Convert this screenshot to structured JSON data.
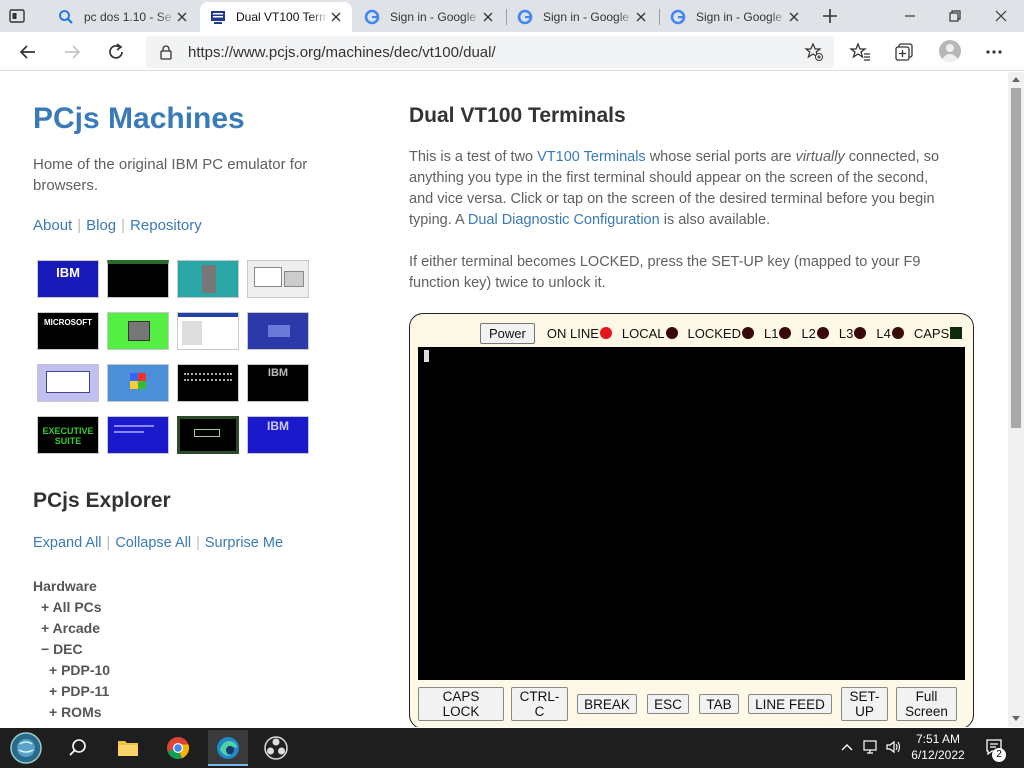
{
  "browser": {
    "tabs": [
      {
        "title": "pc dos 1.10 - Se",
        "favicon": "search-favicon",
        "active": false
      },
      {
        "title": "Dual VT100 Term",
        "favicon": "pcjs-favicon",
        "active": true
      },
      {
        "title": "Sign in - Google",
        "favicon": "google-favicon",
        "active": false
      },
      {
        "title": "Sign in - Google",
        "favicon": "google-favicon",
        "active": false
      },
      {
        "title": "Sign in - Google",
        "favicon": "google-favicon",
        "active": false
      }
    ],
    "url": "https://www.pcjs.org/machines/dec/vt100/dual/"
  },
  "sidebar": {
    "title": "PCjs Machines",
    "description": "Home of the original IBM PC emulator for browsers.",
    "links": [
      "About",
      "Blog",
      "Repository"
    ],
    "thumbnail_labels": [
      "IBM",
      "MICROSOFT",
      "EXECUTIVE SUITE",
      "IBM",
      "IBM"
    ],
    "explorer_title": "PCjs Explorer",
    "explorer_links": [
      "Expand All",
      "Collapse All",
      "Surprise Me"
    ],
    "tree": [
      {
        "label": "Hardware",
        "indent": 0
      },
      {
        "label": "+ All PCs",
        "indent": 1
      },
      {
        "label": "+ Arcade",
        "indent": 1
      },
      {
        "label": "− DEC",
        "indent": 1
      },
      {
        "label": "+ PDP-10",
        "indent": 2
      },
      {
        "label": "+ PDP-11",
        "indent": 2
      },
      {
        "label": "+ ROMs",
        "indent": 2
      }
    ]
  },
  "main": {
    "heading": "Dual VT100 Terminals",
    "intro": {
      "p1": "This is a test of two ",
      "link1": "VT100 Terminals",
      "p2": " whose serial ports are ",
      "em": "virtually",
      "p3": " connected, so anything you type in the first terminal should appear on the screen of the second, and vice versa. Click or tap on the screen of the desired terminal before you begin typing. A ",
      "link2": "Dual Diagnostic Configuration",
      "p4": " is also available."
    },
    "locked_note": "If either terminal becomes LOCKED, press the SET-UP key (mapped to your F9 function key) twice to unlock it."
  },
  "terminal": {
    "power_label": "Power",
    "leds": [
      {
        "label": "ON LINE",
        "color": "#e8141c"
      },
      {
        "label": "LOCAL",
        "color": "#3a0808"
      },
      {
        "label": "LOCKED",
        "color": "#3a0808"
      },
      {
        "label": "L1",
        "color": "#3a0808"
      },
      {
        "label": "L2",
        "color": "#3a0808"
      },
      {
        "label": "L3",
        "color": "#3a0808"
      },
      {
        "label": "L4",
        "color": "#3a0808"
      },
      {
        "label": "CAPS",
        "color": "#0c2a0c"
      }
    ],
    "keys": [
      {
        "l1": "CAPS",
        "l2": "LOCK"
      },
      {
        "l1": "CTRL-",
        "l2": "C"
      },
      {
        "l1": "BREAK",
        "l2": ""
      },
      {
        "l1": "ESC",
        "l2": ""
      },
      {
        "l1": "TAB",
        "l2": ""
      },
      {
        "l1": "LINE FEED",
        "l2": ""
      },
      {
        "l1": "SET-",
        "l2": "UP"
      },
      {
        "l1": "Full",
        "l2": "Screen"
      }
    ]
  },
  "taskbar": {
    "time": "7:51 AM",
    "date": "6/12/2022",
    "notifications": "2"
  },
  "colors": {
    "link": "#3a7ab8",
    "accent": "#76b9ed"
  }
}
